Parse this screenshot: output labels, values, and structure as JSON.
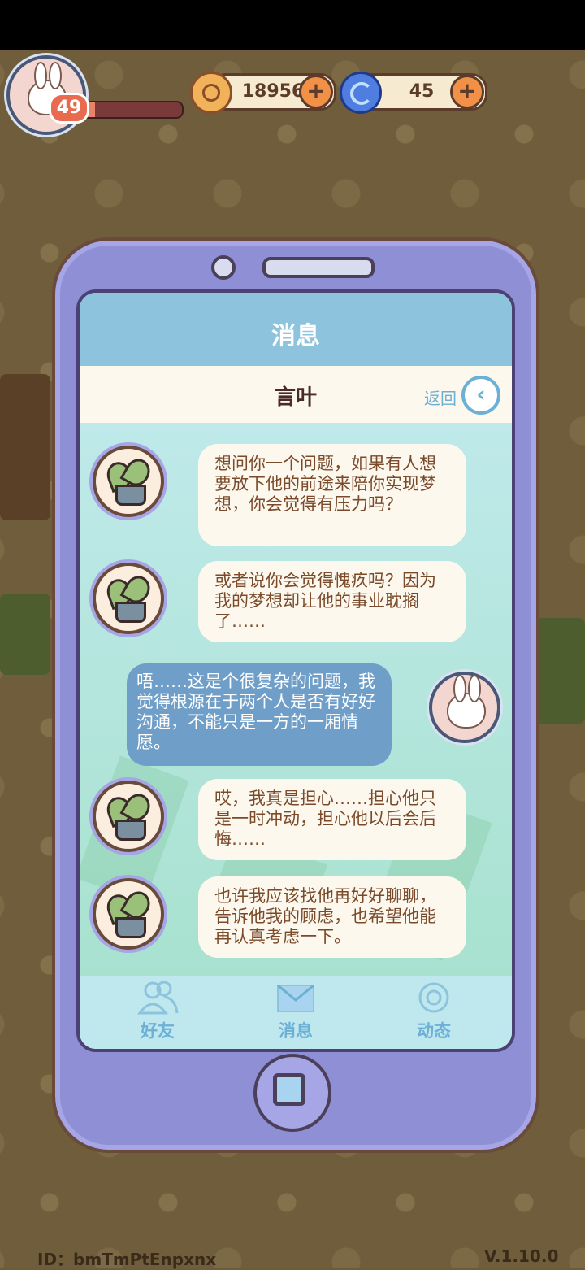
{
  "hud": {
    "level": "49",
    "xp_fraction": 0.12,
    "coins": "18956",
    "gems": "45"
  },
  "screen": {
    "title": "消息",
    "contact_name": "言叶",
    "back_label": "返回"
  },
  "messages": [
    {
      "sender": "npc",
      "text": "想问你一个问题，如果有人想要放下他的前途来陪你实现梦想，你会觉得有压力吗？"
    },
    {
      "sender": "npc",
      "text": "或者说你会觉得愧疚吗？因为我的梦想却让他的事业耽搁了……"
    },
    {
      "sender": "player",
      "text": "唔……这是个很复杂的问题，我觉得根源在于两个人是否有好好沟通，不能只是一方的一厢情愿。"
    },
    {
      "sender": "npc",
      "text": "哎，我真是担心……担心他只是一时冲动，担心他以后会后悔……"
    },
    {
      "sender": "npc",
      "text": "也许我应该找他再好好聊聊，告诉他我的顾虑，也希望他能再认真考虑一下。"
    }
  ],
  "tabs": [
    {
      "label": "好友",
      "icon": "friends-icon"
    },
    {
      "label": "消息",
      "icon": "mail-icon"
    },
    {
      "label": "动态",
      "icon": "activity-icon"
    }
  ],
  "footer": {
    "id_text": "ID：bmTmPtEnpxnx",
    "version": "V.1.10.0"
  },
  "colors": {
    "accent": "#6db0d6",
    "phone_body": "#8f8fd6",
    "bubble_npc": "#fdf8ee",
    "bubble_player": "#6f9fc8"
  }
}
